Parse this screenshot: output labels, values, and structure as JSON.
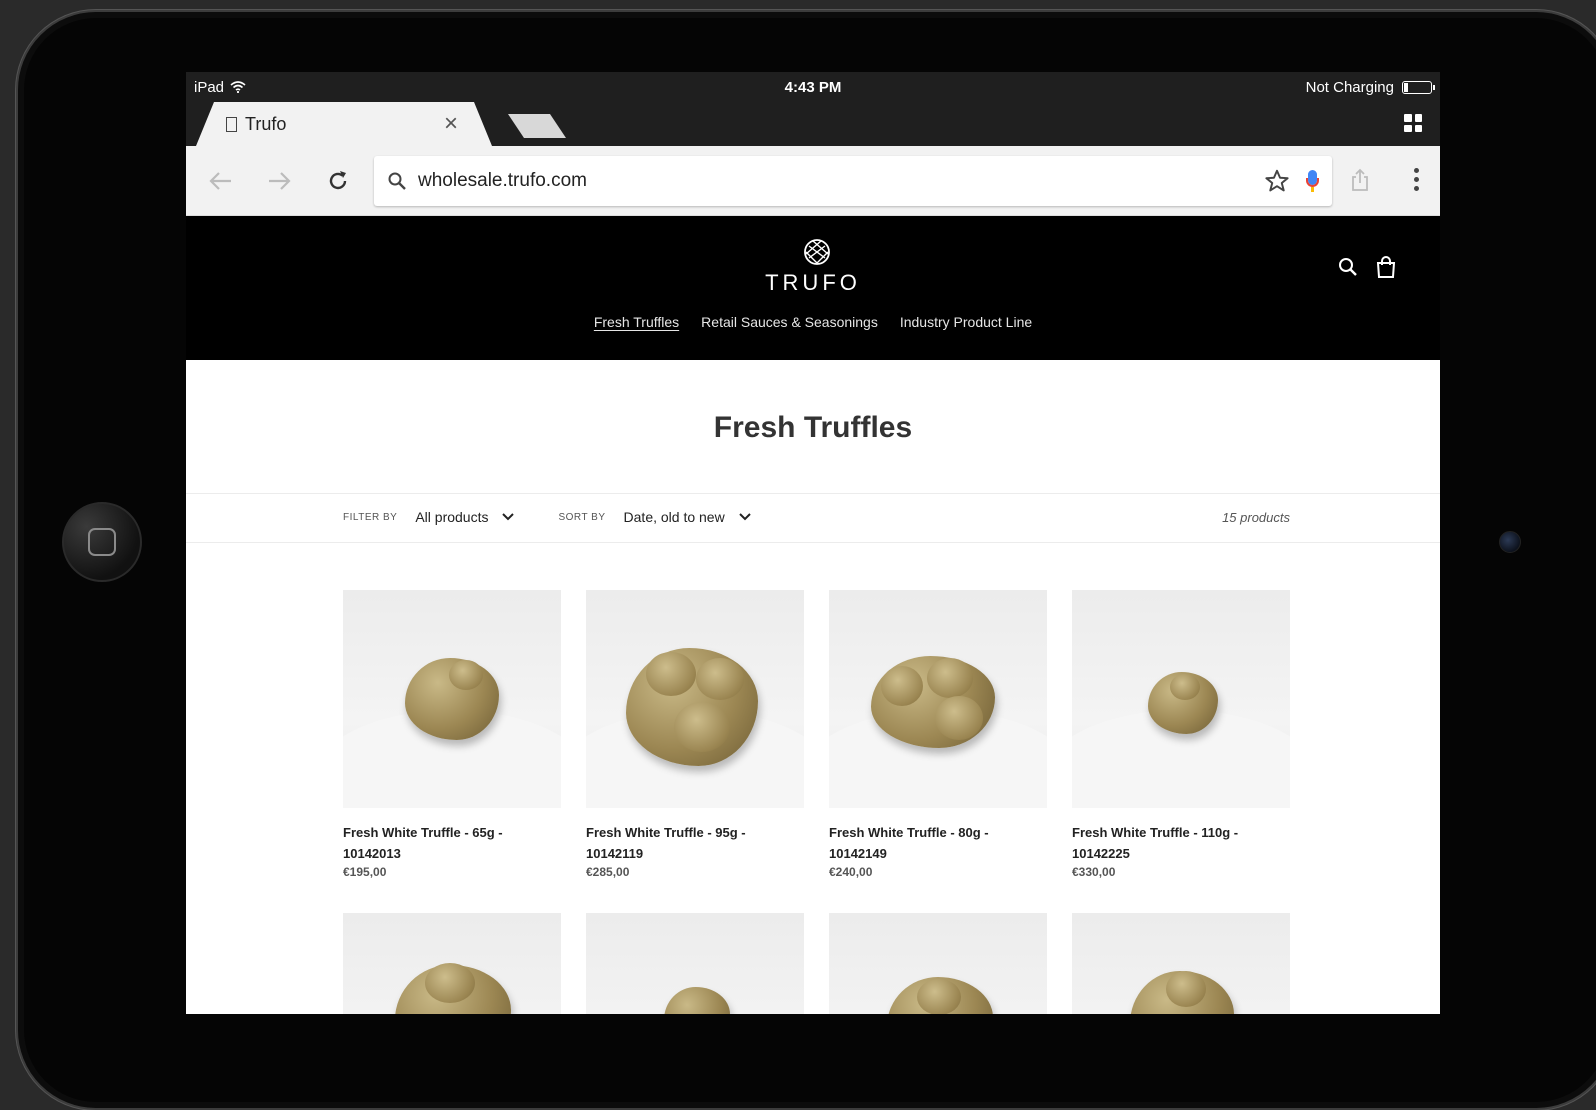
{
  "statusbar": {
    "device": "iPad",
    "time": "4:43 PM",
    "battery_text": "Not Charging",
    "battery_level": 0.15
  },
  "browser": {
    "tab_title": "Trufo",
    "url": "wholesale.trufo.com"
  },
  "site": {
    "logo_text": "TRUFO",
    "nav": [
      "Fresh Truffles",
      "Retail Sauces & Seasonings",
      "Industry Product Line"
    ],
    "active_nav": "Fresh Truffles"
  },
  "collection": {
    "title": "Fresh Truffles",
    "filter_label": "FILTER BY",
    "filter_value": "All products",
    "sort_label": "SORT BY",
    "sort_value": "Date, old to new",
    "count": "15 products"
  },
  "products": [
    {
      "name": "Fresh White Truffle - 65g - 10142013",
      "price": "€195,00"
    },
    {
      "name": "Fresh White Truffle - 95g - 10142119",
      "price": "€285,00"
    },
    {
      "name": "Fresh White Truffle - 80g - 10142149",
      "price": "€240,00"
    },
    {
      "name": "Fresh White Truffle - 110g - 10142225",
      "price": "€330,00"
    }
  ],
  "icons": {
    "wifi": "wifi-icon",
    "battery": "battery-icon",
    "doc": "document-icon",
    "close": "close-icon",
    "tab_switcher": "tab-switcher-icon",
    "back": "back-arrow-icon",
    "forward": "forward-arrow-icon",
    "reload": "reload-icon",
    "search": "search-icon",
    "star": "bookmark-star-icon",
    "mic": "microphone-icon",
    "share": "share-icon",
    "menu": "more-vert-icon",
    "logo": "trufo-logo-icon",
    "bag": "shopping-bag-icon",
    "chevron": "chevron-down-icon",
    "home": "home-button"
  }
}
